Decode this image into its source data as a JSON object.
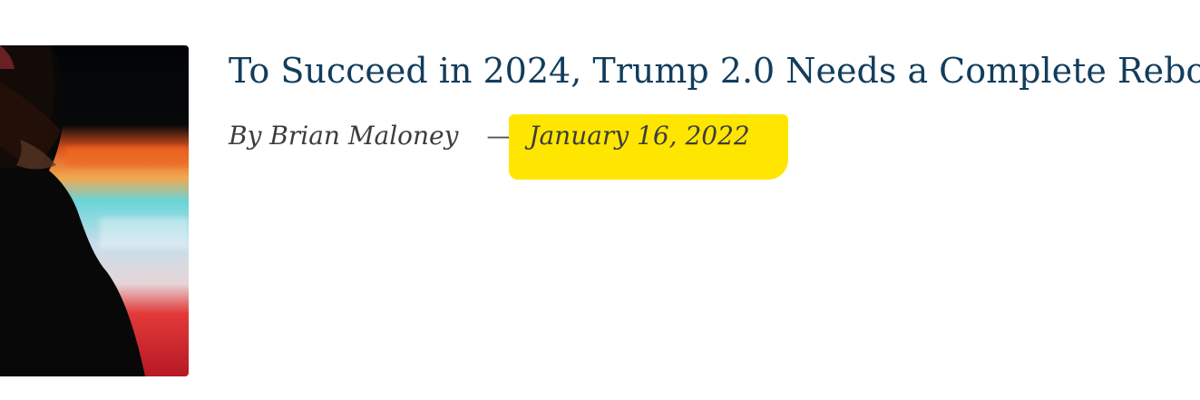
{
  "post": {
    "title": "To Succeed in 2024, Trump 2.0 Needs a Complete Rebo",
    "author": "By Brian Maloney",
    "separator": "—",
    "date": "January 16, 2022",
    "thumbnail_icon": "article-thumbnail-photo"
  },
  "colors": {
    "title": "#123d5c",
    "meta": "#3d3d3d",
    "highlight": "#ffe600"
  }
}
